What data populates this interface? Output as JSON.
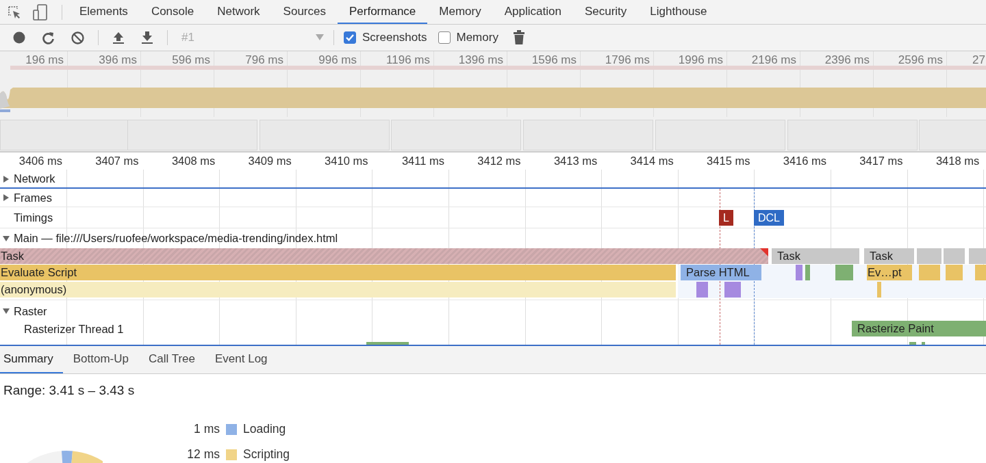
{
  "tabs": [
    {
      "label": "Elements",
      "selected": false
    },
    {
      "label": "Console",
      "selected": false
    },
    {
      "label": "Network",
      "selected": false
    },
    {
      "label": "Sources",
      "selected": false
    },
    {
      "label": "Performance",
      "selected": true
    },
    {
      "label": "Memory",
      "selected": false
    },
    {
      "label": "Application",
      "selected": false
    },
    {
      "label": "Security",
      "selected": false
    },
    {
      "label": "Lighthouse",
      "selected": false
    }
  ],
  "toolbar": {
    "recording": "#1",
    "screenshots": {
      "label": "Screenshots",
      "checked": true
    },
    "memory": {
      "label": "Memory",
      "checked": false
    }
  },
  "overview": {
    "ticks": [
      "196 ms",
      "396 ms",
      "596 ms",
      "796 ms",
      "996 ms",
      "1196 ms",
      "1396 ms",
      "1596 ms",
      "1796 ms",
      "1996 ms",
      "2196 ms",
      "2396 ms",
      "2596 ms",
      "27"
    ]
  },
  "timeline": {
    "ticks": [
      "3406 ms",
      "3407 ms",
      "3408 ms",
      "3409 ms",
      "3410 ms",
      "3411 ms",
      "3412 ms",
      "3413 ms",
      "3414 ms",
      "3415 ms",
      "3416 ms",
      "3417 ms",
      "3418 ms"
    ],
    "tracks": [
      {
        "label": "Network",
        "kind": "group",
        "expanded": false
      },
      {
        "label": "Frames",
        "kind": "group",
        "expanded": false
      },
      {
        "label": "Timings",
        "kind": "plain"
      },
      {
        "label": "Main — file:///Users/ruofee/workspace/media-trending/index.html",
        "kind": "group",
        "expanded": true
      },
      {
        "label": "Raster",
        "kind": "group",
        "expanded": true
      },
      {
        "label": "Rasterizer Thread 1",
        "kind": "sub"
      }
    ],
    "timings": [
      {
        "label": "L",
        "color": "#a52a1f"
      },
      {
        "label": "DCL",
        "color": "#2f6bc5"
      }
    ],
    "events": [
      {
        "label": "Task",
        "kind": "long-task"
      },
      {
        "label": "Task",
        "kind": "task"
      },
      {
        "label": "Task",
        "kind": "task"
      },
      {
        "label": "Evaluate Script",
        "kind": "script"
      },
      {
        "label": "Parse HTML",
        "kind": "loading"
      },
      {
        "label": "Ev…pt",
        "kind": "script"
      },
      {
        "label": "(anonymous)",
        "kind": "function"
      },
      {
        "label": "Rasterize Paint",
        "kind": "painting"
      }
    ]
  },
  "bottom_tabs": [
    {
      "label": "Summary",
      "selected": true
    },
    {
      "label": "Bottom-Up",
      "selected": false
    },
    {
      "label": "Call Tree",
      "selected": false
    },
    {
      "label": "Event Log",
      "selected": false
    }
  ],
  "summary": {
    "range": "Range: 3.41 s – 3.43 s",
    "legend": [
      {
        "value": "1 ms",
        "label": "Loading",
        "color": "#8fb2e6"
      },
      {
        "value": "12 ms",
        "label": "Scripting",
        "color": "#f1d488"
      }
    ]
  }
}
